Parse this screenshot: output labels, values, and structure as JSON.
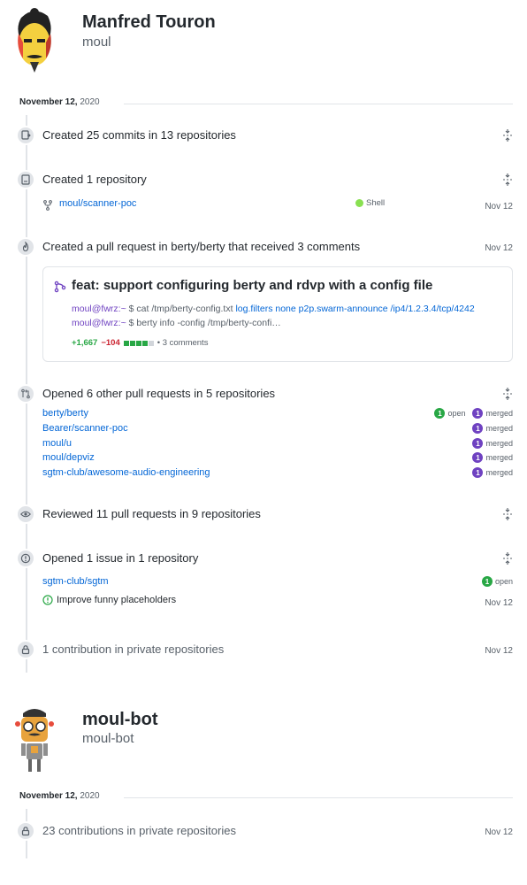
{
  "profiles": [
    {
      "name": "Manfred Touron",
      "login": "moul",
      "date_label": "November 12,",
      "date_year": "2020",
      "items": [
        {
          "title": "Created 25 commits in 13 repositories"
        },
        {
          "title": "Created 1 repository",
          "repo": "moul/scanner-poc",
          "language": "Shell",
          "language_color": "#89e051",
          "date": "Nov 12"
        },
        {
          "title": "Created a pull request in berty/berty that received 3 comments",
          "date": "Nov 12",
          "pr": {
            "title": "feat: support configuring berty and rdvp with a config file",
            "line1_user": "moul@fwrz:~",
            "line1_cmd": " $ cat /tmp/berty-config.txt ",
            "line1_link": "log.filters none p2p.swarm-announce /ip4/1.2.3.4/tcp/4242",
            "line2_user": "moul@fwrz:~",
            "line2_cmd": " $ berty info -config /tmp/berty-confi…",
            "additions": "+1,667",
            "deletions": "−104",
            "comments": "• 3 comments"
          }
        },
        {
          "title": "Opened 6 other pull requests in 5 repositories",
          "repos": [
            {
              "name": "berty/berty",
              "open": "1",
              "open_label": "open",
              "merged": "1",
              "merged_label": "merged"
            },
            {
              "name": "Bearer/scanner-poc",
              "merged": "1",
              "merged_label": "merged"
            },
            {
              "name": "moul/u",
              "merged": "1",
              "merged_label": "merged"
            },
            {
              "name": "moul/depviz",
              "merged": "1",
              "merged_label": "merged"
            },
            {
              "name": "sgtm-club/awesome-audio-engineering",
              "merged": "1",
              "merged_label": "merged"
            }
          ]
        },
        {
          "title": "Reviewed 11 pull requests in 9 repositories"
        },
        {
          "title": "Opened 1 issue in 1 repository",
          "repo": "sgtm-club/sgtm",
          "open": "1",
          "open_label": "open",
          "issue": "Improve funny placeholders",
          "date": "Nov 12"
        },
        {
          "title": "1 contribution in private repositories",
          "date": "Nov 12"
        }
      ]
    },
    {
      "name": "moul-bot",
      "login": "moul-bot",
      "date_label": "November 12,",
      "date_year": "2020",
      "items": [
        {
          "title": "23 contributions in private repositories",
          "date": "Nov 12"
        }
      ]
    }
  ],
  "colors": {
    "link": "#0366d6",
    "open": "#28a745",
    "merged": "#6f42c1",
    "deletions": "#cb2431"
  }
}
